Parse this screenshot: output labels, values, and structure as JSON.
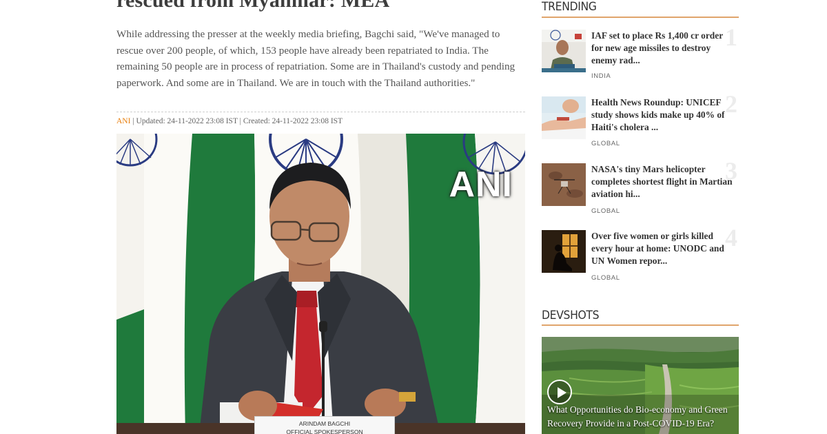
{
  "article": {
    "headline": "rescued from Myanmar: MEA",
    "body": "While addressing the presser at the weekly media briefing, Bagchi said, \"We've managed to rescue over 200 people, of which, 153 people have already been repatriated to India. The remaining 50 people are in process of repatriation. Some are in Thailand's custody and pending paperwork. And some are in Thailand. We are in touch with the Thailand authorities.\"",
    "meta": {
      "source": "ANI",
      "separator": " | ",
      "updated": "Updated: 24-11-2022 23:08 IST",
      "created": "Created: 24-11-2022 23:08 IST"
    },
    "photo": {
      "watermark": "ANI",
      "nameplate_line1": "ARINDAM BAGCHI",
      "nameplate_line2": "OFFICIAL SPOKESPERSON"
    }
  },
  "sidebar": {
    "trending_title": "TRENDING",
    "trending": [
      {
        "title": "IAF set to place Rs 1,400 cr order for new age missiles to destroy enemy rad...",
        "tag": "INDIA",
        "rank": "1",
        "thumb_icon": "press-briefing-thumbnail"
      },
      {
        "title": "Health News Roundup: UNICEF study shows kids make up 40% of Haiti's cholera ...",
        "tag": "GLOBAL",
        "rank": "2",
        "thumb_icon": "medical-hands-thumbnail"
      },
      {
        "title": "NASA's tiny Mars helicopter completes shortest flight in Martian aviation hi...",
        "tag": "GLOBAL",
        "rank": "3",
        "thumb_icon": "mars-helicopter-thumbnail"
      },
      {
        "title": "Over five women or girls killed every hour at home: UNODC and UN Women repor...",
        "tag": "GLOBAL",
        "rank": "4",
        "thumb_icon": "woman-silhouette-thumbnail"
      }
    ],
    "devshots_title": "DEVSHOTS",
    "devshot": {
      "caption": "What Opportunities do Bio-economy and Green Recovery Provide in a Post-COVID-19 Era?",
      "icon": "play-icon"
    }
  },
  "colors": {
    "accent_orange": "#e87e0c",
    "rule_orange": "#e0a46b",
    "flag_green": "#1f7a3c",
    "suit_grey": "#3a3d44",
    "tie_red": "#c4262e"
  }
}
